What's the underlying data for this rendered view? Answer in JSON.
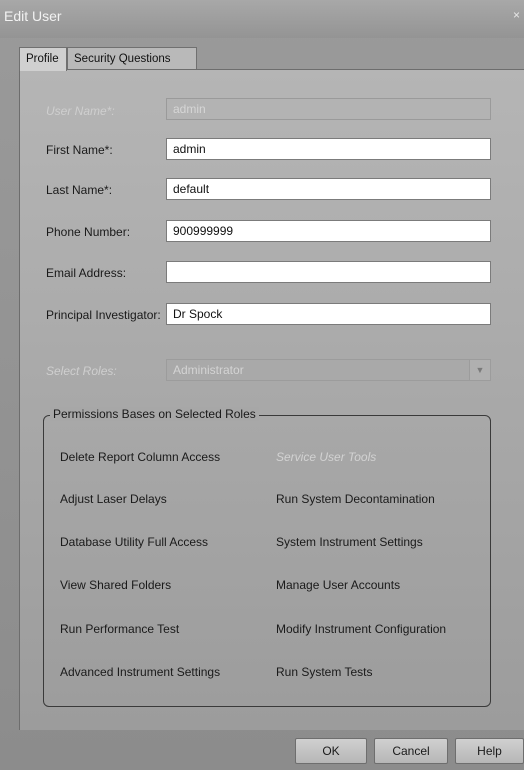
{
  "window": {
    "title": "Edit User",
    "close_glyph": "×"
  },
  "tabs": [
    {
      "label": "Profile",
      "active": true
    },
    {
      "label": "Security Questions",
      "active": false
    }
  ],
  "form": {
    "user_name": {
      "label": "User Name*:",
      "value": "admin",
      "disabled": true
    },
    "first_name": {
      "label": "First Name*:",
      "value": "admin"
    },
    "last_name": {
      "label": "Last Name*:",
      "value": "default"
    },
    "phone": {
      "label": "Phone Number:",
      "value": "900999999"
    },
    "email": {
      "label": "Email Address:",
      "value": ""
    },
    "pi": {
      "label": "Principal Investigator:",
      "value": "Dr Spock"
    },
    "roles": {
      "label": "Select Roles:",
      "value": "Administrator",
      "disabled": true
    }
  },
  "permissions": {
    "title": "Permissions Bases on Selected Roles",
    "left": [
      "Delete Report Column Access",
      "Adjust Laser Delays",
      "Database Utility Full Access",
      "View Shared Folders",
      "Run Performance Test",
      "Advanced Instrument Settings"
    ],
    "right": [
      "Service User Tools",
      "Run System Decontamination",
      "System Instrument Settings",
      "Manage User Accounts",
      "Modify Instrument Configuration",
      "Run System Tests"
    ],
    "right_disabled_index": 0
  },
  "buttons": {
    "ok": "OK",
    "cancel": "Cancel",
    "help": "Help"
  }
}
